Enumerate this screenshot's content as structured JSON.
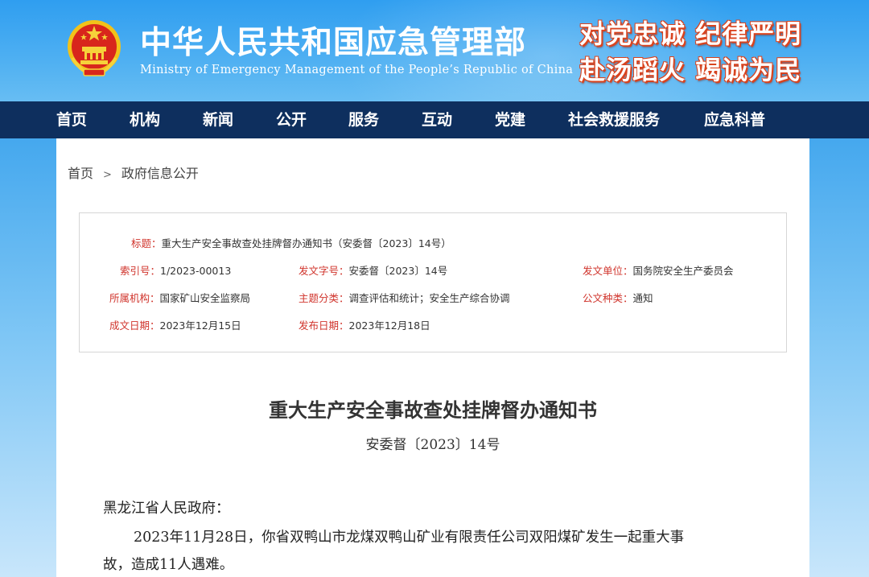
{
  "header": {
    "site_title": "中华人民共和国应急管理部",
    "site_subtitle": "Ministry of Emergency Management of the People’s Republic of China",
    "slogan_line1": "对党忠诚  纪律严明",
    "slogan_line2": "赴汤蹈火  竭诚为民",
    "emblem_icon": "national-emblem-icon"
  },
  "nav": {
    "items": [
      "首页",
      "机构",
      "新闻",
      "公开",
      "服务",
      "互动",
      "党建",
      "社会救援服务",
      "应急科普"
    ]
  },
  "breadcrumb": {
    "home": "首页",
    "separator": ">",
    "current": "政府信息公开"
  },
  "meta": {
    "title_label": "标题：",
    "title_value": "重大生产安全事故查处挂牌督办通知书（安委督〔2023〕14号）",
    "index_label": "索引号：",
    "index_value": "1/2023-00013",
    "doc_no_label": "发文字号：",
    "doc_no_value": "安委督〔2023〕14号",
    "issuer_label": "发文单位：",
    "issuer_value": "国务院安全生产委员会",
    "org_label": "所属机构：",
    "org_value": "国家矿山安全监察局",
    "topic_label": "主题分类：",
    "topic_value": "调查评估和统计；安全生产综合协调",
    "type_label": "公文种类：",
    "type_value": "通知",
    "written_label": "成文日期：",
    "written_value": "2023年12月15日",
    "published_label": "发布日期：",
    "published_value": "2023年12月18日"
  },
  "article": {
    "title": "重大生产安全事故查处挂牌督办通知书",
    "doc_number": "安委督〔2023〕14号",
    "salutation": "黑龙江省人民政府：",
    "body_line1": "2023年11月28日，你省双鸭山市龙煤双鸭山矿业有限责任公司双阳煤矿发生一起重大事",
    "body_line2": "故，造成11人遇难。"
  },
  "colors": {
    "header_blue": "#2f9ef0",
    "nav_navy": "#0e2f5e",
    "label_red": "#d0342c",
    "slogan_stroke": "#d9431e"
  }
}
